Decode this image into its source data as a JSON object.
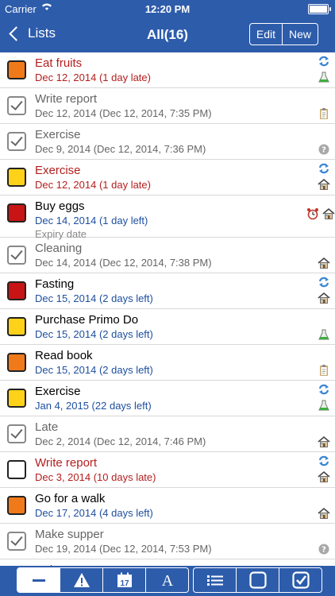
{
  "status": {
    "carrier": "Carrier",
    "time": "12:20 PM"
  },
  "nav": {
    "back_label": "Lists",
    "title": "All(16)",
    "edit_label": "Edit",
    "new_label": "New"
  },
  "colors": {
    "nav_bg": "#2d5cab",
    "late": "#b41e1e",
    "future": "#1e4fa0",
    "done": "#666666",
    "normal": "#000000",
    "orange": "#f07a1a",
    "yellow": "#ffd21a",
    "red": "#c81414"
  },
  "tasks": [
    {
      "title": "Eat fruits",
      "date": "Dec 12, 2014 (1 day late)",
      "state": "late",
      "box": "orange",
      "icons": [
        "repeat-icon",
        "flask-icon"
      ]
    },
    {
      "title": "Write report",
      "date": "Dec 12, 2014 (Dec 12, 2014, 7:35 PM)",
      "state": "done",
      "box": "check",
      "icons": [
        "clipboard-icon"
      ]
    },
    {
      "title": "Exercise",
      "date": "Dec 9, 2014 (Dec 12, 2014, 7:36 PM)",
      "state": "done",
      "box": "check",
      "icons": [
        "question-icon"
      ]
    },
    {
      "title": "Exercise",
      "date": "Dec 12, 2014 (1 day late)",
      "state": "late",
      "box": "yellow",
      "icons": [
        "repeat-icon",
        "house-icon"
      ]
    },
    {
      "title": "Buy eggs",
      "date": "Dec 14, 2014 (1 day left)",
      "note": "Expiry date",
      "state": "future",
      "box": "red",
      "icons": [
        "alarm-icon",
        "house-icon"
      ]
    },
    {
      "title": "Cleaning",
      "date": "Dec 14, 2014 (Dec 12, 2014, 7:38 PM)",
      "state": "done",
      "box": "check",
      "icons": [
        "house-icon"
      ]
    },
    {
      "title": "Fasting",
      "date": "Dec 15, 2014 (2 days left)",
      "state": "future",
      "box": "red",
      "icons": [
        "repeat-icon",
        "house-icon"
      ]
    },
    {
      "title": "Purchase Primo Do",
      "date": "Dec 15, 2014 (2 days left)",
      "state": "future",
      "box": "yellow",
      "icons": [
        "flask-icon"
      ]
    },
    {
      "title": "Read book",
      "date": "Dec 15, 2014 (2 days left)",
      "state": "future",
      "box": "orange",
      "icons": [
        "clipboard-icon"
      ]
    },
    {
      "title": "Exercise",
      "date": "Jan 4, 2015 (22 days left)",
      "state": "future",
      "box": "yellow",
      "icons": [
        "repeat-icon",
        "flask-icon"
      ]
    },
    {
      "title": "Late",
      "date": "Dec 2, 2014 (Dec 12, 2014, 7:46 PM)",
      "state": "done",
      "box": "check",
      "icons": [
        "house-icon"
      ]
    },
    {
      "title": "Write report",
      "date": "Dec 3, 2014 (10 days late)",
      "state": "late",
      "box": "empty",
      "icons": [
        "repeat-icon",
        "house-icon"
      ]
    },
    {
      "title": "Go for a walk",
      "date": "Dec 17, 2014 (4 days left)",
      "state": "future",
      "box": "orange",
      "icons": [
        "house-icon"
      ]
    },
    {
      "title": "Make supper",
      "date": "Dec 19, 2014 (Dec 12, 2014, 7:53 PM)",
      "state": "done",
      "box": "check",
      "icons": [
        "question-icon"
      ]
    },
    {
      "title": "Write report",
      "date": "",
      "state": "late",
      "box": "empty",
      "icons": []
    }
  ],
  "toolbar": {
    "left": [
      {
        "icon": "minus-icon",
        "selected": true
      },
      {
        "icon": "warning-icon"
      },
      {
        "icon": "calendar-icon",
        "text": "17"
      },
      {
        "icon": "font-icon",
        "text": "A"
      }
    ],
    "right": [
      {
        "icon": "list-icon"
      },
      {
        "icon": "empty-box-icon"
      },
      {
        "icon": "checked-box-icon"
      }
    ]
  }
}
